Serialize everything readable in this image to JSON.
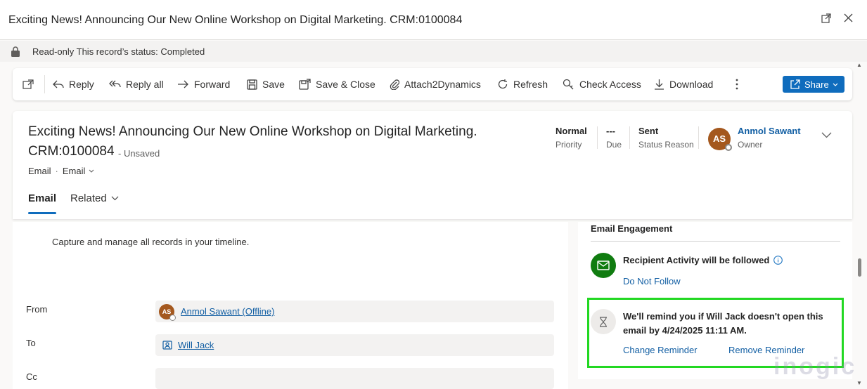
{
  "window": {
    "title": "Exciting News! Announcing Our New Online Workshop on Digital Marketing. CRM:0100084",
    "icons": [
      "expand-icon",
      "close-icon"
    ]
  },
  "notice": {
    "text": "Read-only This record’s status: Completed"
  },
  "toolbar": {
    "reply": "Reply",
    "reply_all": "Reply all",
    "forward": "Forward",
    "save": "Save",
    "save_close": "Save & Close",
    "attach": "Attach2Dynamics",
    "refresh": "Refresh",
    "check_access": "Check Access",
    "download": "Download",
    "share": "Share"
  },
  "header": {
    "title_line1": "Exciting News! Announcing Our New Online Workshop on Digital Marketing.",
    "title_line2": "CRM:0100084",
    "unsaved": "- Unsaved",
    "entity": "Email",
    "form": "Email",
    "priority_value": "Normal",
    "priority_label": "Priority",
    "due_value": "---",
    "due_label": "Due",
    "status_value": "Sent",
    "status_label": "Status Reason",
    "owner_initials": "AS",
    "owner_name": "Anmol Sawant",
    "owner_label": "Owner",
    "tabs": {
      "email": "Email",
      "related": "Related"
    }
  },
  "main": {
    "description": "Capture and manage all records in your timeline.",
    "from_label": "From",
    "from_initials": "AS",
    "from_value": "Anmol Sawant (Offline)",
    "to_label": "To",
    "to_value": "Will Jack",
    "cc_label": "Cc"
  },
  "engagement": {
    "title": "Email Engagement",
    "follow_text": "Recipient Activity will be followed",
    "do_not_follow": "Do Not Follow",
    "reminder_text": "We'll remind you if Will Jack doesn't open this email by 4/24/2025 11:11 AM.",
    "change_reminder": "Change Reminder",
    "remove_reminder": "Remove Reminder"
  },
  "watermark": "inogic",
  "colors": {
    "accent": "#0f6cbd",
    "highlight": "#22d822",
    "engagement_green": "#107c10"
  }
}
